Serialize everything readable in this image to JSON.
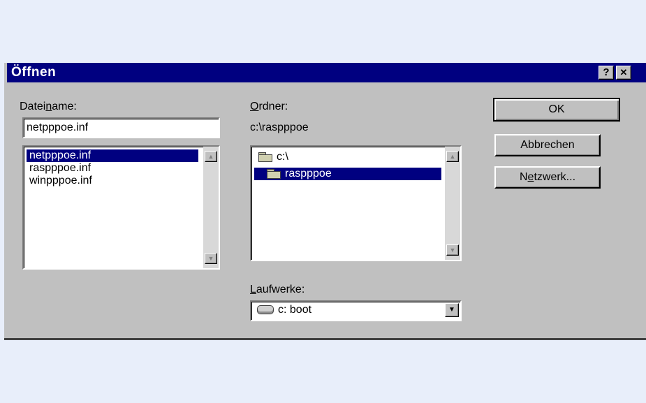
{
  "dialog": {
    "title": "Öffnen",
    "help_label": "?",
    "close_label": "✕"
  },
  "filename": {
    "label_pre": "Datei",
    "label_accel": "n",
    "label_post": "ame:",
    "value": "netpppoe.inf",
    "files": [
      "netpppoe.inf",
      "raspppoe.inf",
      "winpppoe.inf"
    ],
    "selected_index": 0
  },
  "folders": {
    "label_accel": "O",
    "label_post": "rdner:",
    "current_path": "c:\\raspppoe",
    "items": [
      "c:\\",
      "raspppoe"
    ],
    "selected_index": 1
  },
  "drives": {
    "label_accel": "L",
    "label_post": "aufwerke:",
    "selected": "c: boot"
  },
  "buttons": {
    "ok": "OK",
    "cancel": "Abbrechen",
    "network_pre": "N",
    "network_accel": "e",
    "network_post": "tzwerk..."
  },
  "icons": {
    "folder": "folder-icon",
    "drive": "drive-icon",
    "scroll_up": "scroll-up-icon",
    "scroll_down": "scroll-down-icon",
    "dropdown": "chevron-down-icon"
  }
}
